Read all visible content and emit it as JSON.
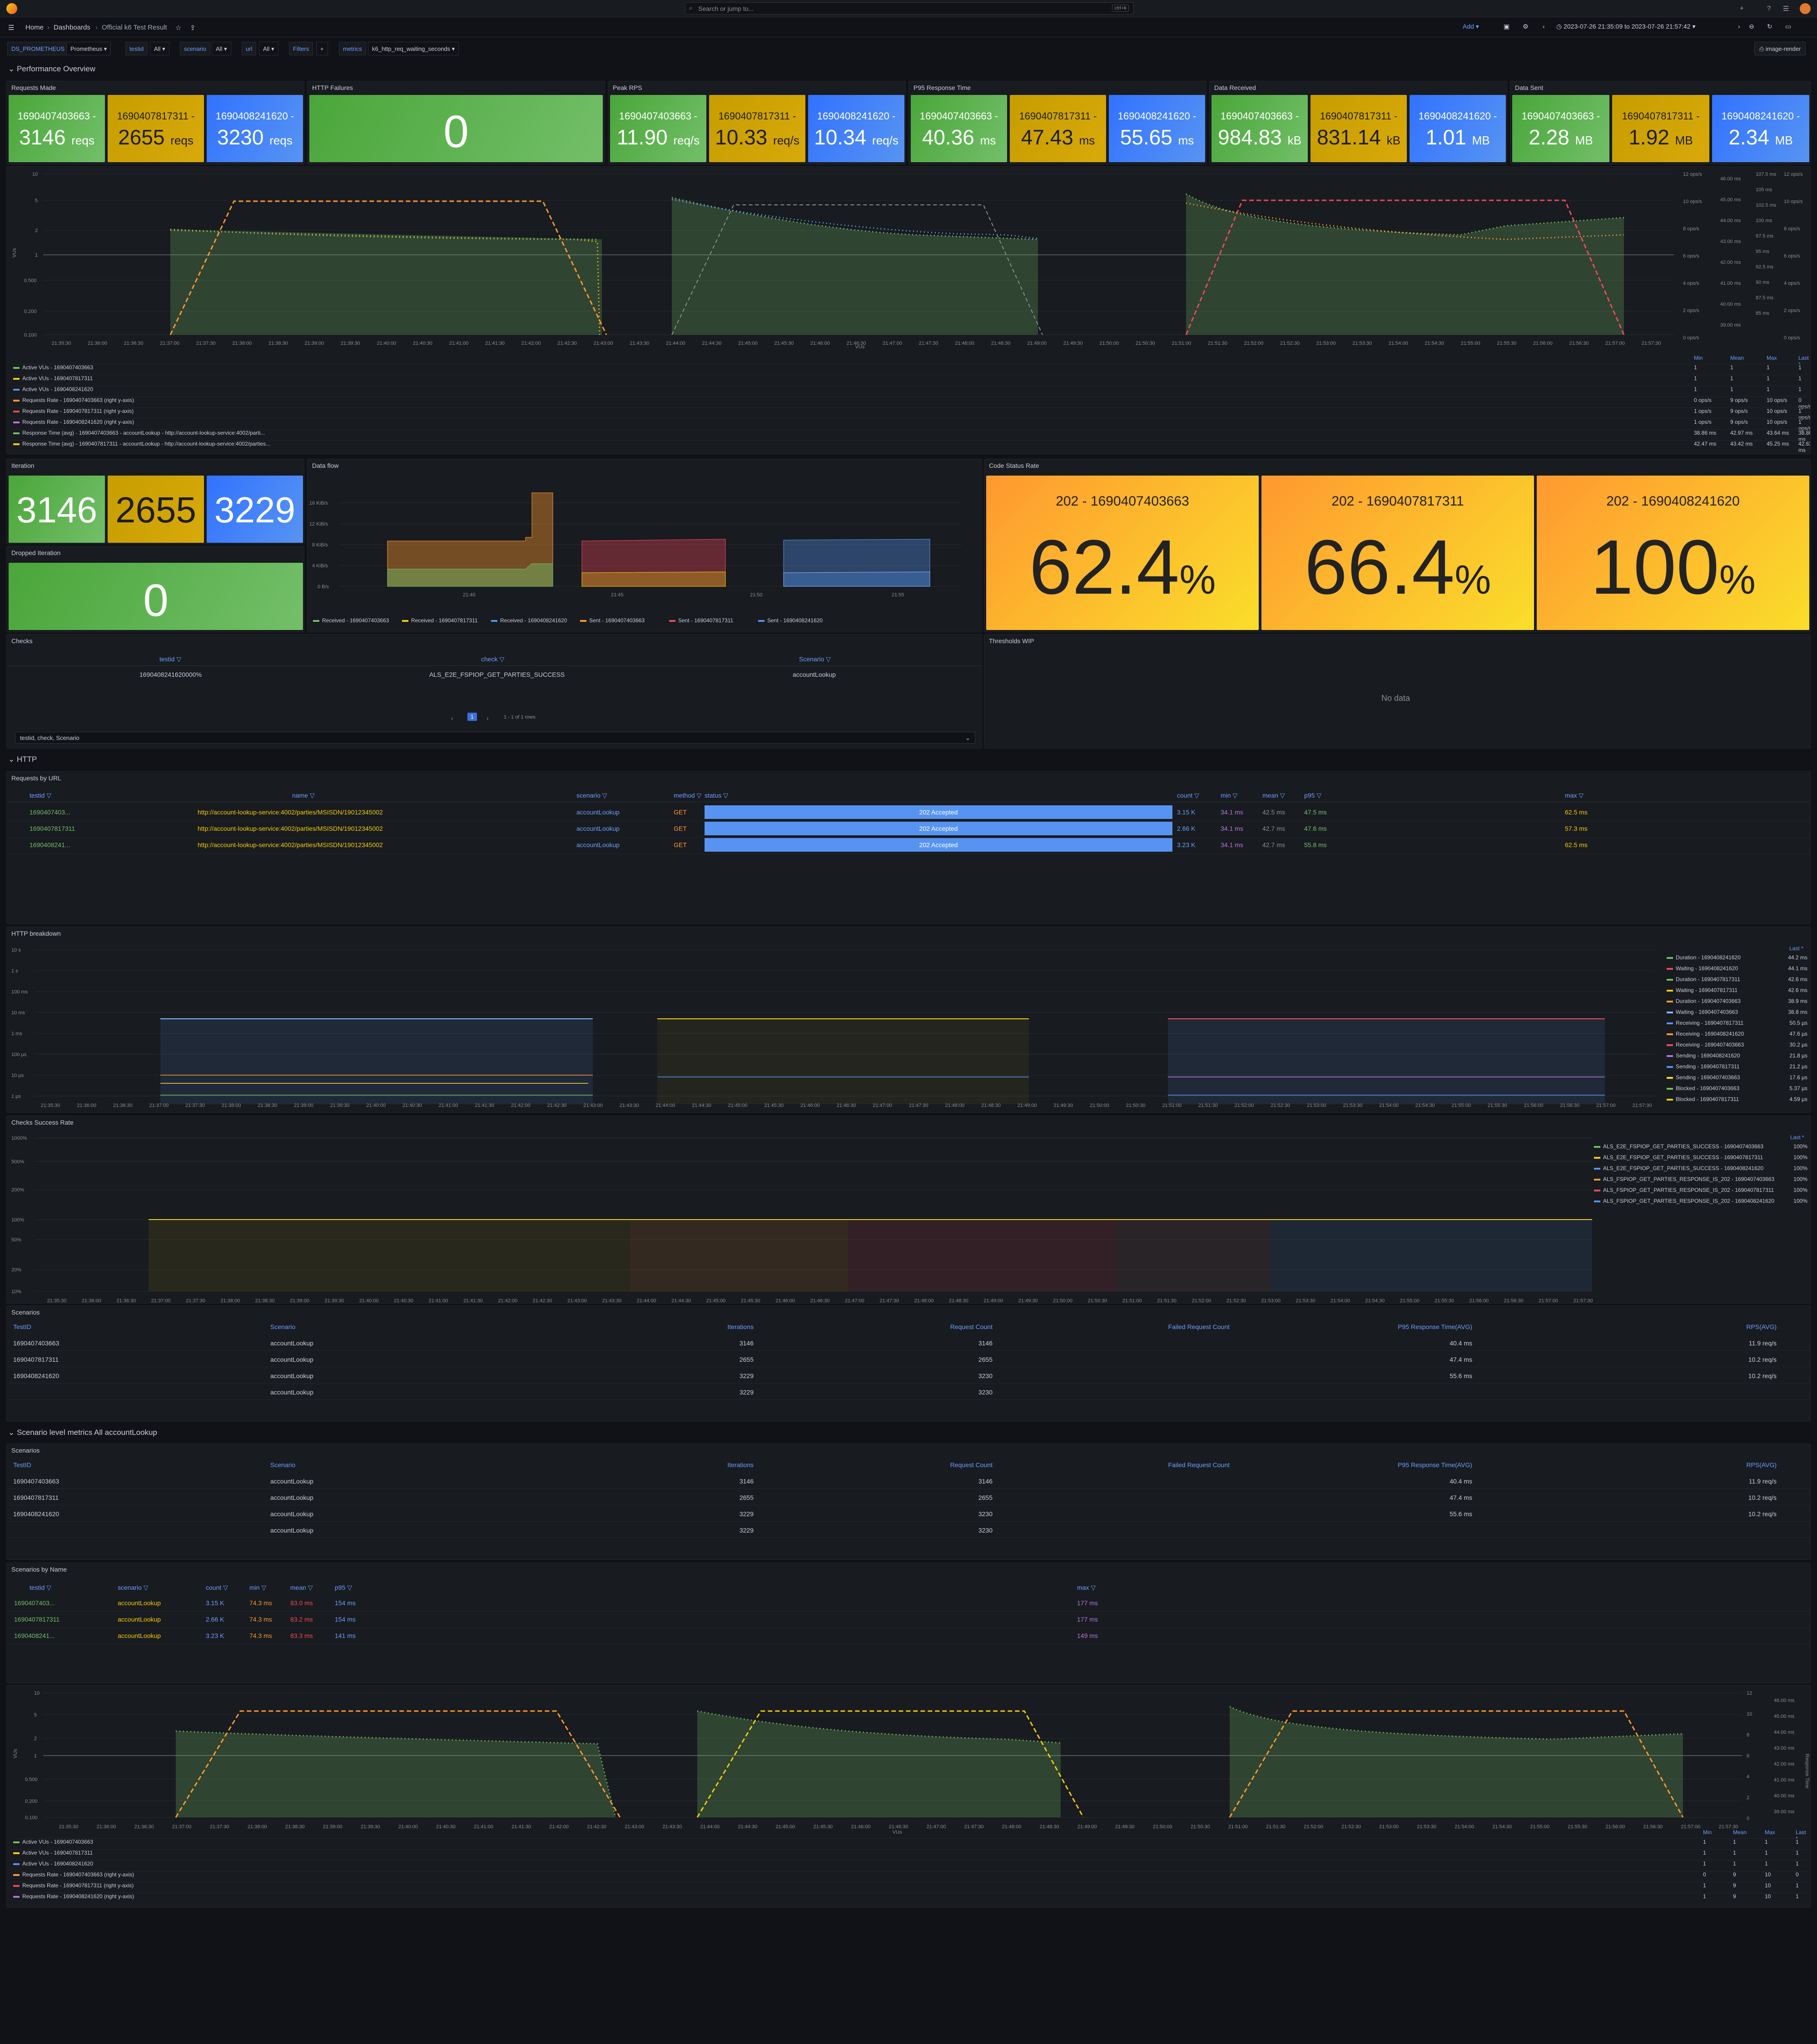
{
  "app": {
    "search_placeholder": "Search or jump to...",
    "search_kbd": "ctrl+k",
    "breadcrumb": [
      "Home",
      "Dashboards",
      "Official k6 Test Result"
    ],
    "add_label": "Add",
    "time_range": "2023-07-26 21:35:09 to 2023-07-26 21:57:42",
    "image_render": "image-render"
  },
  "variables": [
    {
      "label": "DS_PROMETHEUS",
      "value": "Prometheus"
    },
    {
      "label": "testid",
      "value": "All"
    },
    {
      "label": "scenario",
      "value": "All"
    },
    {
      "label": "url",
      "value": "All"
    },
    {
      "label": "Filters",
      "value": "+"
    },
    {
      "label": "metrics",
      "value": "k6_http_req_waiting_seconds"
    }
  ],
  "rows": {
    "perf": "Performance Overview",
    "http": "HTTP",
    "scenario": "Scenario level metrics All accountLookup"
  },
  "stats": [
    {
      "title": "Requests Made",
      "items": [
        {
          "name": "1690407403663 -",
          "value": "3146",
          "unit": "reqs"
        },
        {
          "name": "1690407817311 -",
          "value": "2655",
          "unit": "reqs"
        },
        {
          "name": "1690408241620 -",
          "value": "3230",
          "unit": "reqs"
        }
      ]
    },
    {
      "title": "HTTP Failures",
      "items": [
        {
          "name": "",
          "value": "0",
          "unit": ""
        }
      ]
    },
    {
      "title": "Peak RPS",
      "items": [
        {
          "name": "1690407403663 -",
          "value": "11.90",
          "unit": "req/s"
        },
        {
          "name": "1690407817311 -",
          "value": "10.33",
          "unit": "req/s"
        },
        {
          "name": "1690408241620 -",
          "value": "10.34",
          "unit": "req/s"
        }
      ]
    },
    {
      "title": "P95 Response Time",
      "items": [
        {
          "name": "1690407403663 -",
          "value": "40.36",
          "unit": "ms"
        },
        {
          "name": "1690407817311 -",
          "value": "47.43",
          "unit": "ms"
        },
        {
          "name": "1690408241620 -",
          "value": "55.65",
          "unit": "ms"
        }
      ]
    },
    {
      "title": "Data Received",
      "items": [
        {
          "name": "1690407403663 -",
          "value": "984.83",
          "unit": "kB"
        },
        {
          "name": "1690407817311 -",
          "value": "831.14",
          "unit": "kB"
        },
        {
          "name": "1690408241620 -",
          "value": "1.01",
          "unit": "MB"
        }
      ]
    },
    {
      "title": "Data Sent",
      "items": [
        {
          "name": "1690407403663 -",
          "value": "2.28",
          "unit": "MB"
        },
        {
          "name": "1690407817311 -",
          "value": "1.92",
          "unit": "MB"
        },
        {
          "name": "1690408241620 -",
          "value": "2.34",
          "unit": "MB"
        }
      ]
    }
  ],
  "vus_chart": {
    "ylabel": "VUs",
    "xlabel": "VUs",
    "yticks": [
      "10",
      "5",
      "2",
      "1",
      "0.500",
      "0.200",
      "0.100"
    ],
    "xticks": [
      "21:35:30",
      "21:36:00",
      "21:36:30",
      "21:37:00",
      "21:37:30",
      "21:38:00",
      "21:38:30",
      "21:39:00",
      "21:39:30",
      "21:40:00",
      "21:40:30",
      "21:41:00",
      "21:41:30",
      "21:42:00",
      "21:42:30",
      "21:43:00",
      "21:43:30",
      "21:44:00",
      "21:44:30",
      "21:45:00",
      "21:45:30",
      "21:46:00",
      "21:46:30",
      "21:47:00",
      "21:47:30",
      "21:48:00",
      "21:48:30",
      "21:49:00",
      "21:49:30",
      "21:50:00",
      "21:50:30",
      "21:51:00",
      "21:51:30",
      "21:52:00",
      "21:52:30",
      "21:53:00",
      "21:53:30",
      "21:54:00",
      "21:54:30",
      "21:55:00",
      "21:55:30",
      "21:56:00",
      "21:56:30",
      "21:57:00",
      "21:57:30"
    ],
    "right_axis1": [
      "12 ops/s",
      "10 ops/s",
      "8 ops/s",
      "6 ops/s",
      "4 ops/s",
      "2 ops/s",
      "0 ops/s"
    ],
    "right_axis2": [
      "46.00 ms",
      "45.00 ms",
      "44.00 ms",
      "43.00 ms",
      "42.00 ms",
      "41.00 ms",
      "40.00 ms",
      "39.00 ms"
    ],
    "right_axis3": [
      "107.5 ms",
      "105 ms",
      "102.5 ms",
      "100 ms",
      "97.5 ms",
      "95 ms",
      "92.5 ms",
      "90 ms",
      "87.5 ms",
      "85 ms"
    ],
    "right_axis4": [
      "12 ops/s",
      "10 ops/s",
      "8 ops/s",
      "6 ops/s",
      "4 ops/s",
      "2 ops/s",
      "0 ops/s"
    ],
    "legend_headers": [
      "Min",
      "Mean",
      "Max",
      "Last *"
    ],
    "legend": [
      {
        "name": "Active VUs - 1690407403663",
        "color": "#73bf69",
        "vals": [
          "1",
          "1",
          "1",
          "1"
        ]
      },
      {
        "name": "Active VUs - 1690407817311",
        "color": "#f2cc0c",
        "vals": [
          "1",
          "1",
          "1",
          "1"
        ]
      },
      {
        "name": "Active VUs - 1690408241620",
        "color": "#5794f2",
        "vals": [
          "1",
          "1",
          "1",
          "1"
        ]
      },
      {
        "name": "Requests Rate - 1690407403663 (right y-axis)",
        "color": "#ff9830",
        "vals": [
          "0 ops/s",
          "9 ops/s",
          "10 ops/s",
          "0 ops/s"
        ]
      },
      {
        "name": "Requests Rate - 1690407817311 (right y-axis)",
        "color": "#f2495c",
        "vals": [
          "1 ops/s",
          "9 ops/s",
          "10 ops/s",
          "1 ops/s"
        ]
      },
      {
        "name": "Requests Rate - 1690408241620 (right y-axis)",
        "color": "#b877d9",
        "vals": [
          "1 ops/s",
          "9 ops/s",
          "10 ops/s",
          "1 ops/s"
        ]
      },
      {
        "name": "Response Time (avg) - 1690407403663 - accountLookup - http://account-lookup-service:4002/parti...",
        "color": "#73bf69",
        "vals": [
          "38.86 ms",
          "42.97 ms",
          "43.64 ms",
          "38.86 ms"
        ]
      },
      {
        "name": "Response Time (avg) - 1690407817311 - accountLookup - http://account-lookup-service:4002/parties...",
        "color": "#f2cc0c",
        "vals": [
          "42.47 ms",
          "43.42 ms",
          "45.25 ms",
          "42.63 ms"
        ]
      }
    ]
  },
  "iteration": {
    "title": "Iteration",
    "items": [
      {
        "name": "1690407403663",
        "value": "3146"
      },
      {
        "name": "1690407817311",
        "value": "2655"
      },
      {
        "name": "1690408241620",
        "value": "3229"
      }
    ]
  },
  "dropped": {
    "title": "Dropped Iteration",
    "value": "0"
  },
  "dataflow": {
    "title": "Data flow",
    "yticks": [
      "16 KiB/s",
      "12 KiB/s",
      "8 KiB/s",
      "4 KiB/s",
      "0 B/s"
    ],
    "xticks": [
      "21:40",
      "21:45",
      "21:50",
      "21:55"
    ],
    "legend": [
      {
        "name": "Received - 1690407403663",
        "color": "#73bf69"
      },
      {
        "name": "Received - 1690407817311",
        "color": "#f2cc0c"
      },
      {
        "name": "Received - 1690408241620",
        "color": "#5794f2"
      },
      {
        "name": "Sent - 1690407403663",
        "color": "#ff9830"
      },
      {
        "name": "Sent - 1690407817311",
        "color": "#f2495c"
      },
      {
        "name": "Sent - 1690408241620",
        "color": "#5794f2"
      }
    ]
  },
  "codestatus": {
    "title": "Code Status Rate",
    "items": [
      {
        "name": "202 - 1690407403663",
        "value": "62.4",
        "unit": "%"
      },
      {
        "name": "202 - 1690407817311",
        "value": "66.4",
        "unit": "%"
      },
      {
        "name": "202 - 1690408241620",
        "value": "100",
        "unit": "%"
      }
    ]
  },
  "checks": {
    "title": "Checks",
    "headers": [
      "testid",
      "check",
      "Scenario"
    ],
    "row": [
      "1690408241620000%",
      "ALS_E2E_FSPIOP_GET_PARTIES_SUCCESS",
      "accountLookup"
    ],
    "pager": "1 - 1 of 1 rows",
    "page": "1",
    "footer": "testid, check, Scenario"
  },
  "thresholds": {
    "title": "Thresholds WIP",
    "nodata": "No data"
  },
  "req_by_url": {
    "title": "Requests by URL",
    "headers": [
      "testid",
      "name",
      "scenario",
      "method",
      "status",
      "count",
      "min",
      "mean",
      "p95",
      "max"
    ],
    "rows": [
      [
        "1690407403...",
        "http://account-lookup-service:4002/parties/MSISDN/19012345002",
        "accountLookup",
        "GET",
        "202 Accepted",
        "3.15 K",
        "34.1 ms",
        "42.5 ms",
        "47.5 ms",
        "62.5 ms"
      ],
      [
        "1690407817311",
        "http://account-lookup-service:4002/parties/MSISDN/19012345002",
        "accountLookup",
        "GET",
        "202 Accepted",
        "2.66 K",
        "34.1 ms",
        "42.7 ms",
        "47.6 ms",
        "57.3 ms"
      ],
      [
        "1690408241...",
        "http://account-lookup-service:4002/parties/MSISDN/19012345002",
        "accountLookup",
        "GET",
        "202 Accepted",
        "3.23 K",
        "34.1 ms",
        "42.7 ms",
        "55.8 ms",
        "62.5 ms"
      ]
    ]
  },
  "http_breakdown": {
    "title": "HTTP breakdown",
    "yticks": [
      "10 s",
      "1 s",
      "100 ms",
      "10 ms",
      "1 ms",
      "100 µs",
      "10 µs",
      "1 µs"
    ],
    "last_header": "Last *",
    "legend": [
      {
        "name": "Duration - 1690408241620",
        "color": "#73bf69",
        "val": "44.2 ms"
      },
      {
        "name": "Waiting - 1690408241620",
        "color": "#f2495c",
        "val": "44.1 ms"
      },
      {
        "name": "Duration - 1690407817311",
        "color": "#73bf69",
        "val": "42.6 ms"
      },
      {
        "name": "Waiting - 1690407817311",
        "color": "#f2cc0c",
        "val": "42.6 ms"
      },
      {
        "name": "Duration - 1690407403663",
        "color": "#ff9830",
        "val": "38.9 ms"
      },
      {
        "name": "Waiting - 1690407403663",
        "color": "#8ab8ff",
        "val": "38.8 ms"
      },
      {
        "name": "Receiving - 1690407817311",
        "color": "#5794f2",
        "val": "50.5 µs"
      },
      {
        "name": "Receiving - 1690408241620",
        "color": "#ff9830",
        "val": "47.6 µs"
      },
      {
        "name": "Receiving - 1690407403663",
        "color": "#f2495c",
        "val": "30.2 µs"
      },
      {
        "name": "Sending - 1690408241620",
        "color": "#b877d9",
        "val": "21.8 µs"
      },
      {
        "name": "Sending - 1690407817311",
        "color": "#5794f2",
        "val": "21.2 µs"
      },
      {
        "name": "Sending - 1690407403663",
        "color": "#fade2a",
        "val": "17.6 µs"
      },
      {
        "name": "Blocked - 1690407403663",
        "color": "#73bf69",
        "val": "5.37 µs"
      },
      {
        "name": "Blocked - 1690407817311",
        "color": "#f2cc0c",
        "val": "4.59 µs"
      }
    ]
  },
  "checks_rate": {
    "title": "Checks Success Rate",
    "yticks": [
      "1000%",
      "500%",
      "200%",
      "100%",
      "50%",
      "20%",
      "10%"
    ],
    "last_header": "Last *",
    "legend": [
      {
        "name": "ALS_E2E_FSPIOP_GET_PARTIES_SUCCESS - 1690407403663",
        "color": "#73bf69",
        "val": "100%"
      },
      {
        "name": "ALS_E2E_FSPIOP_GET_PARTIES_SUCCESS - 1690407817311",
        "color": "#f2cc0c",
        "val": "100%"
      },
      {
        "name": "ALS_E2E_FSPIOP_GET_PARTIES_SUCCESS - 1690408241620",
        "color": "#5794f2",
        "val": "100%"
      },
      {
        "name": "ALS_FSPIOP_GET_PARTIES_RESPONSE_IS_202 - 1690407403663",
        "color": "#ff9830",
        "val": "100%"
      },
      {
        "name": "ALS_FSPIOP_GET_PARTIES_RESPONSE_IS_202 - 1690407817311",
        "color": "#f2495c",
        "val": "100%"
      },
      {
        "name": "ALS_FSPIOP_GET_PARTIES_RESPONSE_IS_202 - 1690408241620",
        "color": "#5794f2",
        "val": "100%"
      }
    ]
  },
  "scenarios": {
    "title": "Scenarios",
    "headers": [
      "TestID",
      "Scenario",
      "Iterations",
      "Request Count",
      "Failed Request Count",
      "P95 Response Time(AVG)",
      "RPS(AVG)"
    ],
    "rows": [
      [
        "1690407403663",
        "accountLookup",
        "3146",
        "3146",
        "",
        "40.4 ms",
        "11.9 req/s"
      ],
      [
        "1690407817311",
        "accountLookup",
        "2655",
        "2655",
        "",
        "47.4 ms",
        "10.2 req/s"
      ],
      [
        "1690408241620",
        "accountLookup",
        "3229",
        "3230",
        "",
        "55.6 ms",
        "10.2 req/s"
      ],
      [
        "",
        "accountLookup",
        "3229",
        "3230",
        "",
        "",
        ""
      ]
    ]
  },
  "scen_by_name": {
    "title": "Scenarios by Name",
    "headers": [
      "testid",
      "scenario",
      "count",
      "min",
      "mean",
      "p95",
      "max"
    ],
    "rows": [
      [
        "1690407403...",
        "accountLookup",
        "3.15 K",
        "74.3 ms",
        "83.0 ms",
        "154 ms",
        "177 ms"
      ],
      [
        "1690407817311",
        "accountLookup",
        "2.66 K",
        "74.3 ms",
        "83.2 ms",
        "154 ms",
        "177 ms"
      ],
      [
        "1690408241...",
        "accountLookup",
        "3.23 K",
        "74.3 ms",
        "83.3 ms",
        "141 ms",
        "149 ms"
      ]
    ]
  },
  "vus2": {
    "ylabel": "VUs",
    "xlabel": "VUs",
    "yticks": [
      "10",
      "5",
      "2",
      "1",
      "0.500",
      "0.200",
      "0.100"
    ],
    "right1": [
      "12",
      "10",
      "8",
      "6",
      "4",
      "2",
      "0"
    ],
    "right2": [
      "46.00 ms",
      "45.00 ms",
      "44.00 ms",
      "43.00 ms",
      "42.00 ms",
      "41.00 ms",
      "40.00 ms",
      "39.00 ms"
    ],
    "right2_label": "Response Time",
    "legend_headers": [
      "Min",
      "Mean",
      "Max",
      "Last *"
    ],
    "legend": [
      {
        "name": "Active VUs - 1690407403663",
        "color": "#73bf69",
        "vals": [
          "1",
          "1",
          "1",
          "1"
        ]
      },
      {
        "name": "Active VUs - 1690407817311",
        "color": "#f2cc0c",
        "vals": [
          "1",
          "1",
          "1",
          "1"
        ]
      },
      {
        "name": "Active VUs - 1690408241620",
        "color": "#5794f2",
        "vals": [
          "1",
          "1",
          "1",
          "1"
        ]
      },
      {
        "name": "Requests Rate - 1690407403663 (right y-axis)",
        "color": "#ff9830",
        "vals": [
          "0",
          "9",
          "10",
          "0"
        ]
      },
      {
        "name": "Requests Rate - 1690407817311 (right y-axis)",
        "color": "#f2495c",
        "vals": [
          "1",
          "9",
          "10",
          "1"
        ]
      },
      {
        "name": "Requests Rate - 1690408241620 (right y-axis)",
        "color": "#b877d9",
        "vals": [
          "1",
          "9",
          "10",
          "1"
        ]
      }
    ]
  }
}
